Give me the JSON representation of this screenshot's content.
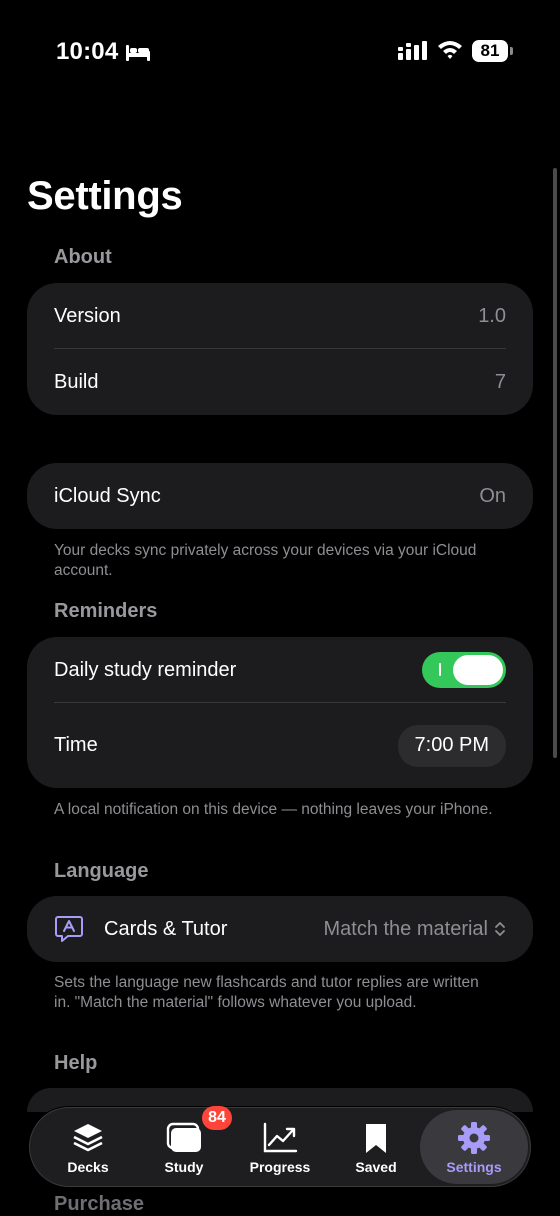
{
  "status_bar": {
    "time": "10:04",
    "battery": "81"
  },
  "page": {
    "title": "Settings"
  },
  "about": {
    "header": "About",
    "version_label": "Version",
    "version_value": "1.0",
    "build_label": "Build",
    "build_value": "7"
  },
  "icloud": {
    "label": "iCloud Sync",
    "value": "On",
    "footnote": "Your decks sync privately across your devices via your iCloud account."
  },
  "reminders": {
    "header": "Reminders",
    "daily_label": "Daily study reminder",
    "daily_enabled": true,
    "time_label": "Time",
    "time_value": "7:00 PM",
    "footnote": "A local notification on this device — nothing leaves your iPhone."
  },
  "language": {
    "header": "Language",
    "label": "Cards & Tutor",
    "value": "Match the material",
    "footnote": "Sets the language new flashcards and tutor replies are written in. \"Match the material\" follows whatever you upload."
  },
  "help": {
    "header": "Help"
  },
  "purchase": {
    "header": "Purchase"
  },
  "tabbar": {
    "tabs": [
      {
        "label": "Decks",
        "icon": "stack-icon"
      },
      {
        "label": "Study",
        "icon": "cards-icon",
        "badge": "84"
      },
      {
        "label": "Progress",
        "icon": "chart-icon"
      },
      {
        "label": "Saved",
        "icon": "bookmark-icon"
      },
      {
        "label": "Settings",
        "icon": "gear-icon",
        "active": true
      }
    ]
  },
  "colors": {
    "accent": "#a79cf7",
    "toggle_on": "#34c759",
    "badge": "#ff453a"
  }
}
